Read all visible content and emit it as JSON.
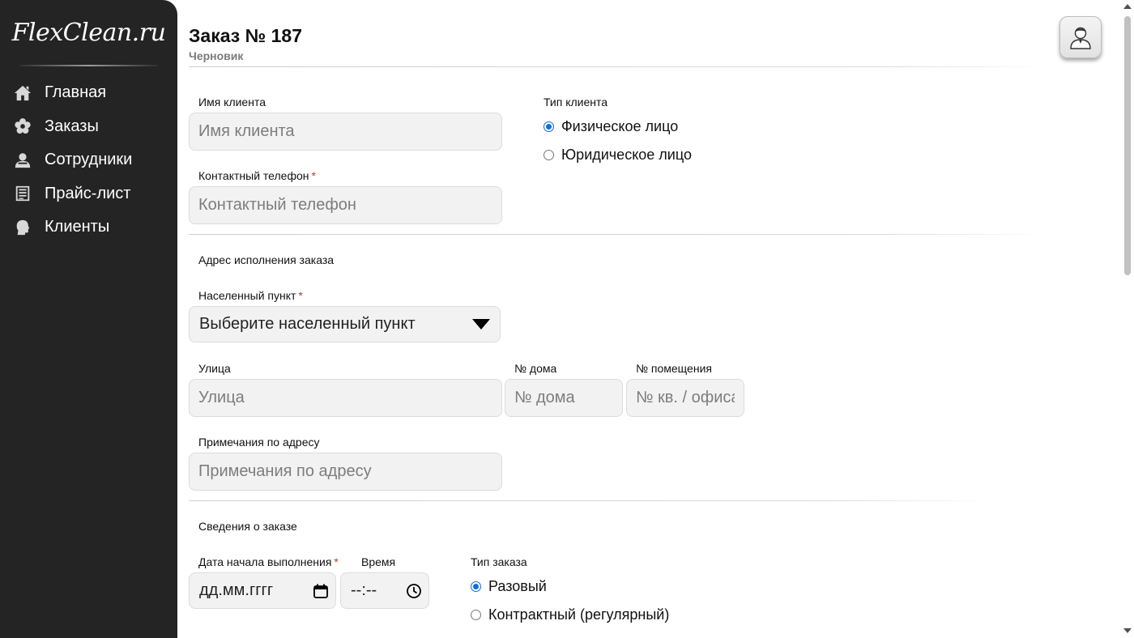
{
  "sidebar": {
    "logo": "FlexClean.ru",
    "items": [
      {
        "label": "Главная",
        "icon": "home-icon"
      },
      {
        "label": "Заказы",
        "icon": "flower-icon"
      },
      {
        "label": "Сотрудники",
        "icon": "staff-icon"
      },
      {
        "label": "Прайс-лист",
        "icon": "price-list-icon"
      },
      {
        "label": "Клиенты",
        "icon": "client-icon"
      }
    ]
  },
  "header": {
    "title": "Заказ № 187",
    "status": "Черновик",
    "avatar_icon": "user-avatar-icon"
  },
  "client": {
    "name_label": "Имя клиента",
    "name_placeholder": "Имя клиента",
    "phone_label": "Контактный телефон",
    "phone_placeholder": "Контактный телефон",
    "required_mark": "*",
    "type_label": "Тип клиента",
    "type_options": [
      "Физическое лицо",
      "Юридическое лицо"
    ],
    "type_selected": 0
  },
  "address": {
    "section_label": "Адрес исполнения заказа",
    "city_label": "Населенный пункт",
    "city_placeholder": "Выберите населенный пункт",
    "street_label": "Улица",
    "street_placeholder": "Улица",
    "house_label": "№ дома",
    "house_placeholder": "№ дома",
    "room_label": "№ помещения",
    "room_placeholder": "№ кв. / офиса",
    "notes_label": "Примечания по адресу",
    "notes_placeholder": "Примечания по адресу"
  },
  "order": {
    "section_label": "Сведения о заказе",
    "start_date_label": "Дата начала выполнения",
    "start_date_value": "дд.мм.гггг",
    "time_label": "Время",
    "time_value": "--:--",
    "type_label": "Тип заказа",
    "type_options": [
      "Разовый",
      "Контрактный (регулярный)"
    ],
    "type_selected": 0
  },
  "colors": {
    "sidebar_bg": "#242424",
    "accent": "#0b6fe0",
    "required": "#c0392b",
    "field_bg": "#f2f2f2"
  }
}
